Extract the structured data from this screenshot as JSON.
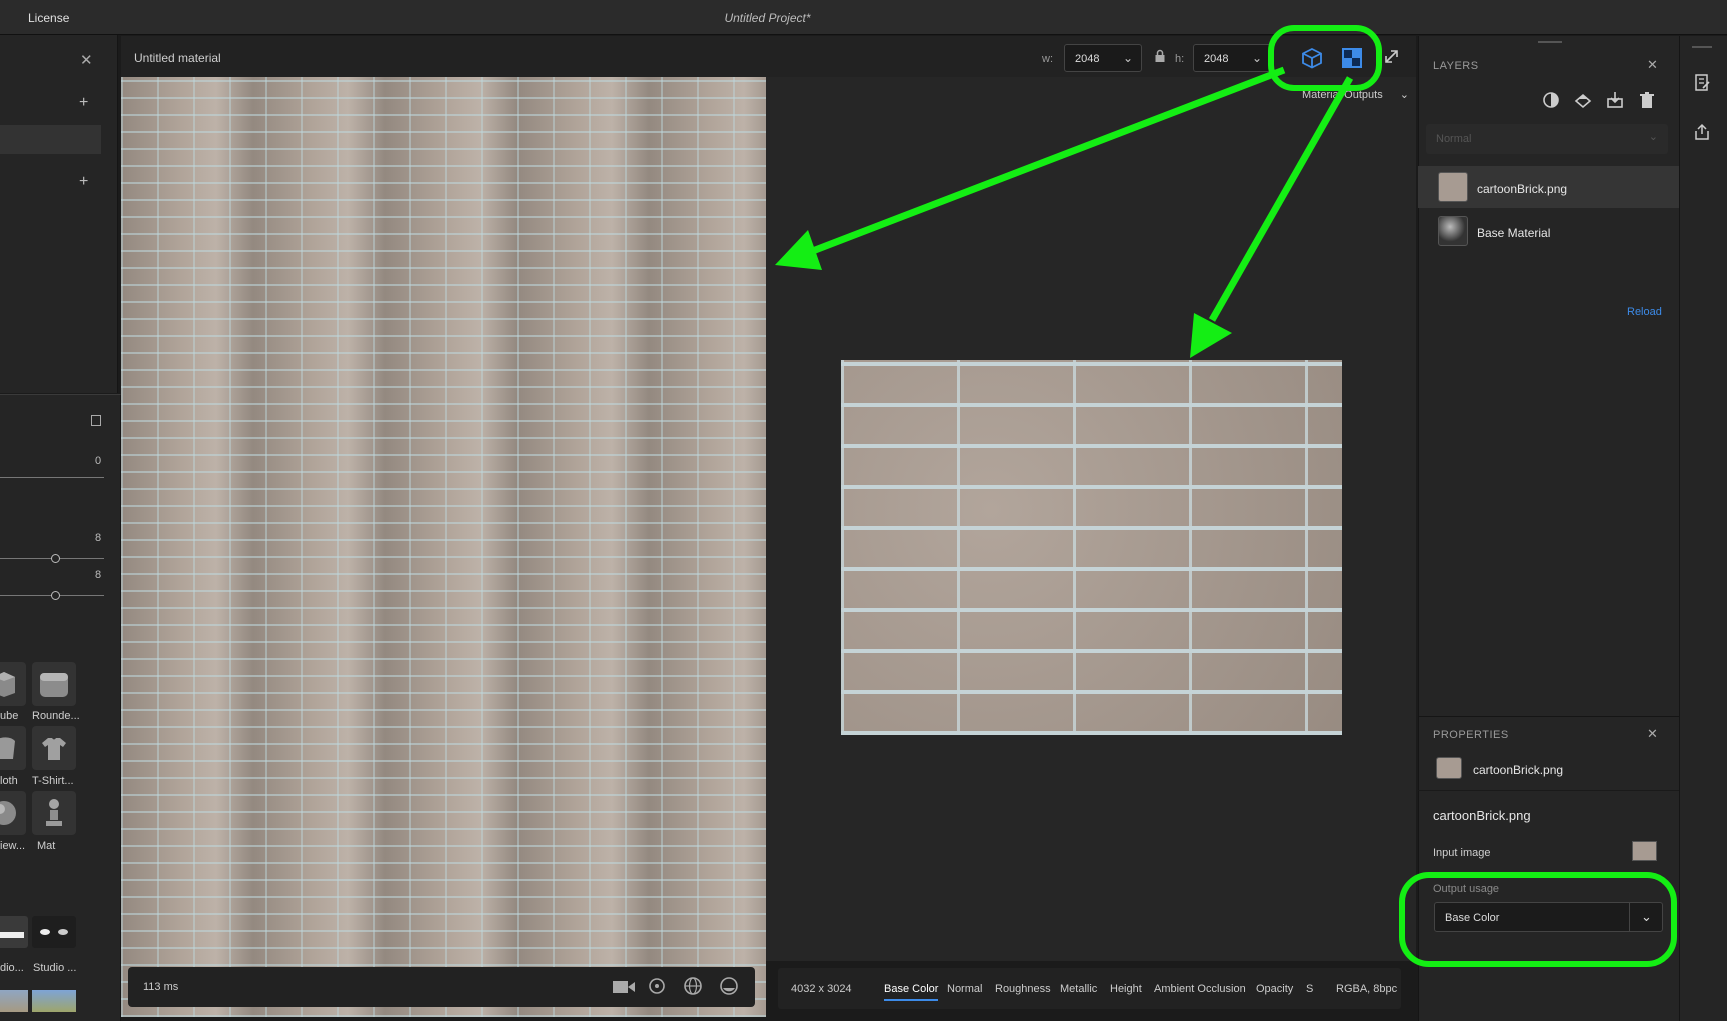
{
  "app": {
    "menu": [
      "License"
    ],
    "project_title": "Untitled Project*"
  },
  "left_panel": {
    "values": [
      "0",
      "8",
      "8"
    ],
    "shapes": [
      {
        "label": "ube",
        "icon": "cube-icon"
      },
      {
        "label": "Rounde...",
        "icon": "rounded-cube-icon"
      },
      {
        "label": "loth",
        "icon": "cloth-icon"
      },
      {
        "label": "T-Shirt...",
        "icon": "tshirt-icon"
      },
      {
        "label": "iew...",
        "icon": "sphere-icon"
      },
      {
        "label": "Mat",
        "icon": "mat-figure-icon"
      }
    ],
    "environments": [
      {
        "label": "dio..."
      },
      {
        "label": "Studio ..."
      }
    ]
  },
  "viewport": {
    "material_name": "Untitled material",
    "width_label": "w:",
    "width_value": "2048",
    "height_label": "h:",
    "height_value": "2048",
    "material_outputs_label": "Material Outputs",
    "render_time": "113 ms",
    "image_size": "4032 x 3024",
    "output_tabs": [
      "Base Color",
      "Normal",
      "Roughness",
      "Metallic",
      "Height",
      "Ambient Occlusion",
      "Opacity",
      "S"
    ],
    "active_output_tab": "Base Color",
    "format": "RGBA, 8bpc"
  },
  "layers_panel": {
    "title": "LAYERS",
    "blend_mode": "Normal",
    "layers": [
      {
        "name": "cartoonBrick.png",
        "selected": true
      },
      {
        "name": "Base Material",
        "selected": false
      }
    ],
    "reload_label": "Reload"
  },
  "properties_panel": {
    "title": "PROPERTIES",
    "layer_name": "cartoonBrick.png",
    "heading": "cartoonBrick.png",
    "input_image_label": "Input image",
    "output_usage_label": "Output usage",
    "output_usage_value": "Base Color"
  },
  "colors": {
    "accent": "#3d8be8",
    "annotation": "#14ee14",
    "background": "#1b1b1b",
    "panel": "#252525"
  }
}
